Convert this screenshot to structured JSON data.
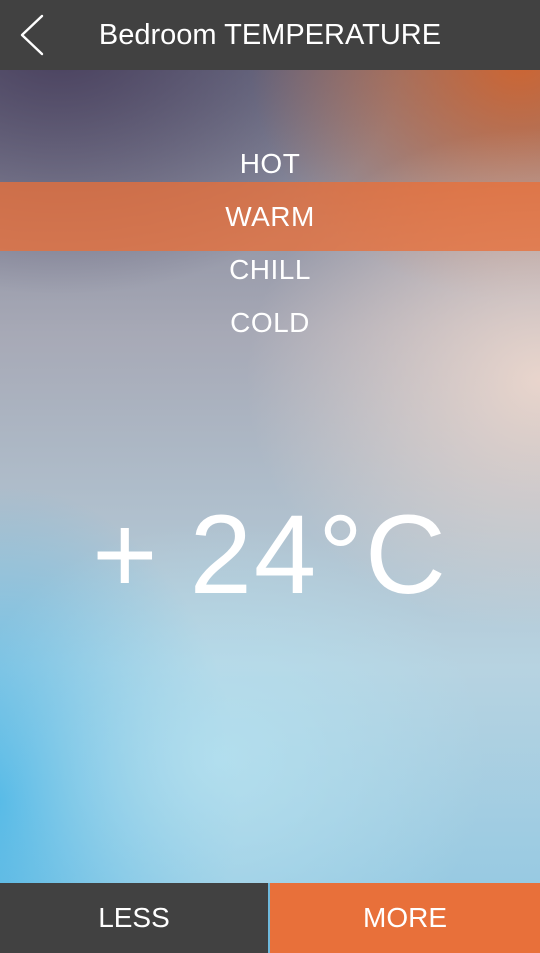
{
  "header": {
    "title": "Bedroom TEMPERATURE",
    "back_icon": "chevron-left-icon"
  },
  "modes": {
    "items": [
      {
        "label": "HOT",
        "selected": false
      },
      {
        "label": "WARM",
        "selected": true
      },
      {
        "label": "CHILL",
        "selected": false
      },
      {
        "label": "COLD",
        "selected": false
      }
    ]
  },
  "temperature": {
    "sign": "+",
    "value": "24°C"
  },
  "footer": {
    "less_label": "LESS",
    "more_label": "MORE"
  },
  "colors": {
    "header_bg": "#414141",
    "accent": "#e8703a",
    "text": "#ffffff"
  }
}
